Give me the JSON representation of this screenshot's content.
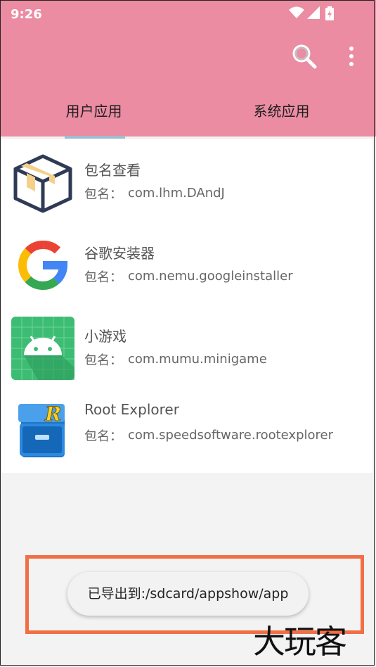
{
  "status_bar": {
    "time": "9:26",
    "icons": [
      "wifi-icon",
      "signal-icon",
      "battery-icon"
    ]
  },
  "toolbar": {
    "actions": [
      "search-icon",
      "more-vert-icon"
    ]
  },
  "tabs": [
    {
      "label": "用户应用",
      "selected": true
    },
    {
      "label": "系统应用",
      "selected": false
    }
  ],
  "apps": [
    {
      "name": "包名查看",
      "package_label": "包名：",
      "package": "com.lhm.DAndJ",
      "icon": "package-box-icon"
    },
    {
      "name": "谷歌安装器",
      "package_label": "包名：",
      "package": "com.nemu.googleinstaller",
      "icon": "google-icon"
    },
    {
      "name": "小游戏",
      "package_label": "包名：",
      "package": "com.mumu.minigame",
      "icon": "android-icon"
    },
    {
      "name": "Root Explorer",
      "package_label": "包名：",
      "package": "com.speedsoftware.rootexplorer",
      "icon": "root-explorer-icon"
    }
  ],
  "toast": {
    "text": "已导出到:/sdcard/appshow/app"
  },
  "watermark": {
    "text": "大玩客"
  },
  "colors": {
    "header": "#eb8ca2",
    "tab_indicator": "#9fbdd0",
    "highlight": "#f26f45"
  }
}
